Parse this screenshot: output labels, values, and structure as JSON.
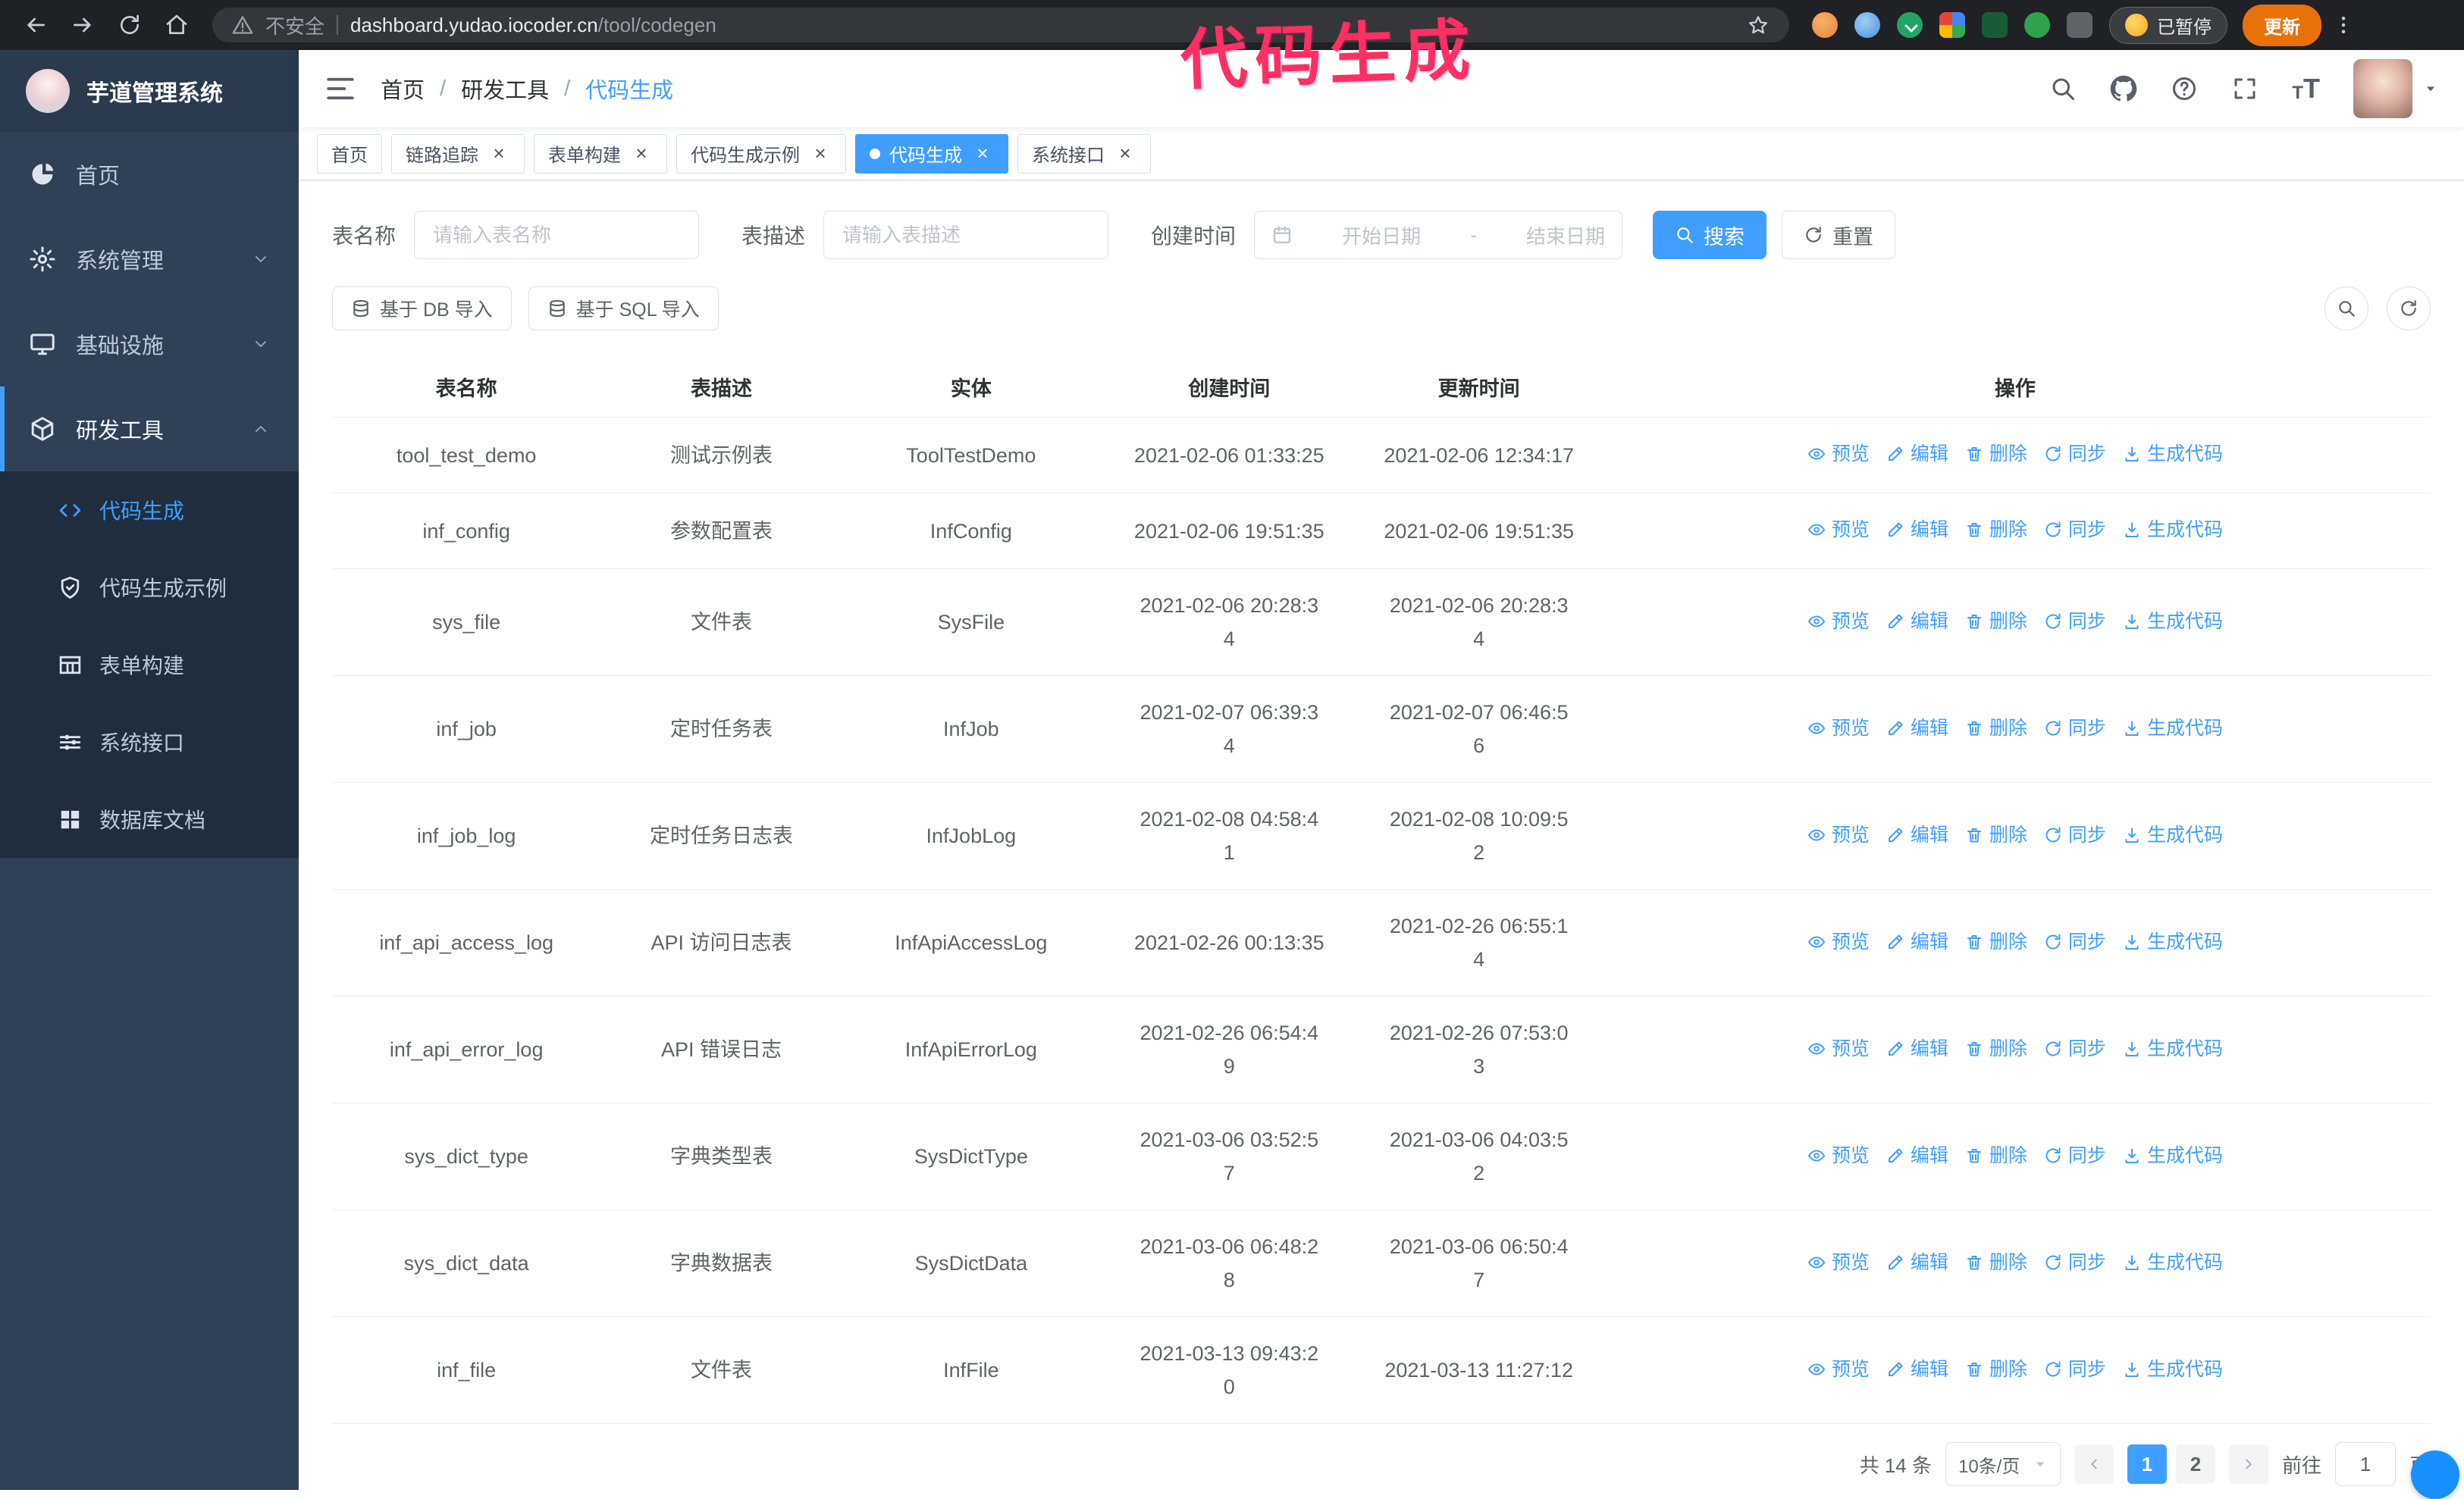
{
  "annotation": {
    "text": "代码生成",
    "color": "#ff2e63"
  },
  "colors": {
    "accent": "#409eff",
    "sidebar_bg": "#304156",
    "annotation": "#ff2e63",
    "update_button": "#e8710a"
  },
  "browser": {
    "security_label": "不安全",
    "url_host": "dashboard.yudao.iocoder.cn",
    "url_path": "/tool/codegen",
    "paused_badge": "已暂停",
    "update_button": "更新"
  },
  "sidebar": {
    "app_title": "芋道管理系统",
    "items": [
      {
        "id": "home",
        "label": "首页",
        "icon": "dashboard",
        "expandable": false
      },
      {
        "id": "system",
        "label": "系统管理",
        "icon": "gear",
        "expandable": true
      },
      {
        "id": "infra",
        "label": "基础设施",
        "icon": "monitor",
        "expandable": true
      },
      {
        "id": "dev-tools",
        "label": "研发工具",
        "icon": "cube",
        "expandable": true,
        "expanded": true,
        "active_parent": true
      }
    ],
    "subitems": [
      {
        "id": "codegen",
        "label": "代码生成",
        "icon": "code",
        "active": true
      },
      {
        "id": "codegen-example",
        "label": "代码生成示例",
        "icon": "shield"
      },
      {
        "id": "form-builder",
        "label": "表单构建",
        "icon": "table"
      },
      {
        "id": "system-api",
        "label": "系统接口",
        "icon": "sliders"
      },
      {
        "id": "db-doc",
        "label": "数据库文档",
        "icon": "grid"
      }
    ]
  },
  "header": {
    "breadcrumb": [
      "首页",
      "研发工具",
      "代码生成"
    ]
  },
  "tabs": [
    {
      "id": "home",
      "label": "首页",
      "closable": false
    },
    {
      "id": "tracer",
      "label": "链路追踪",
      "closable": true
    },
    {
      "id": "form-builder",
      "label": "表单构建",
      "closable": true
    },
    {
      "id": "codegen-example",
      "label": "代码生成示例",
      "closable": true
    },
    {
      "id": "codegen",
      "label": "代码生成",
      "closable": true,
      "active": true
    },
    {
      "id": "system-api",
      "label": "系统接口",
      "closable": true
    }
  ],
  "filters": {
    "table_name_label": "表名称",
    "table_name_placeholder": "请输入表名称",
    "table_desc_label": "表描述",
    "table_desc_placeholder": "请输入表描述",
    "create_time_label": "创建时间",
    "date_start_placeholder": "开始日期",
    "date_separator": "-",
    "date_end_placeholder": "结束日期",
    "search_button": "搜索",
    "reset_button": "重置"
  },
  "toolbar": {
    "import_db_button": "基于 DB 导入",
    "import_sql_button": "基于 SQL 导入"
  },
  "table": {
    "columns": [
      "表名称",
      "表描述",
      "实体",
      "创建时间",
      "更新时间",
      "操作"
    ],
    "ops": [
      {
        "id": "preview",
        "label": "预览",
        "icon": "eye"
      },
      {
        "id": "edit",
        "label": "编辑",
        "icon": "edit"
      },
      {
        "id": "delete",
        "label": "删除",
        "icon": "delete"
      },
      {
        "id": "sync",
        "label": "同步",
        "icon": "sync"
      },
      {
        "id": "generate-code",
        "label": "生成代码",
        "icon": "download"
      }
    ],
    "rows": [
      {
        "name": "tool_test_demo",
        "desc": "测试示例表",
        "entity": "ToolTestDemo",
        "created": "2021-02-06 01:33:25",
        "updated": "2021-02-06 12:34:17"
      },
      {
        "name": "inf_config",
        "desc": "参数配置表",
        "entity": "InfConfig",
        "created": "2021-02-06 19:51:35",
        "updated": "2021-02-06 19:51:35"
      },
      {
        "name": "sys_file",
        "desc": "文件表",
        "entity": "SysFile",
        "created": "2021-02-06 20:28:3\n4",
        "updated": "2021-02-06 20:28:3\n4"
      },
      {
        "name": "inf_job",
        "desc": "定时任务表",
        "entity": "InfJob",
        "created": "2021-02-07 06:39:3\n4",
        "updated": "2021-02-07 06:46:5\n6"
      },
      {
        "name": "inf_job_log",
        "desc": "定时任务日志表",
        "entity": "InfJobLog",
        "created": "2021-02-08 04:58:4\n1",
        "updated": "2021-02-08 10:09:5\n2"
      },
      {
        "name": "inf_api_access_log",
        "desc": "API 访问日志表",
        "entity": "InfApiAccessLog",
        "created": "2021-02-26 00:13:35",
        "updated": "2021-02-26 06:55:1\n4"
      },
      {
        "name": "inf_api_error_log",
        "desc": "API 错误日志",
        "entity": "InfApiErrorLog",
        "created": "2021-02-26 06:54:4\n9",
        "updated": "2021-02-26 07:53:0\n3"
      },
      {
        "name": "sys_dict_type",
        "desc": "字典类型表",
        "entity": "SysDictType",
        "created": "2021-03-06 03:52:5\n7",
        "updated": "2021-03-06 04:03:5\n2"
      },
      {
        "name": "sys_dict_data",
        "desc": "字典数据表",
        "entity": "SysDictData",
        "created": "2021-03-06 06:48:2\n8",
        "updated": "2021-03-06 06:50:4\n7"
      },
      {
        "name": "inf_file",
        "desc": "文件表",
        "entity": "InfFile",
        "created": "2021-03-13 09:43:2\n0",
        "updated": "2021-03-13 11:27:12"
      }
    ]
  },
  "pagination": {
    "total": "共 14 条",
    "page_size": "10条/页",
    "pages": [
      "1",
      "2"
    ],
    "active_page": "1",
    "goto_label": "前往",
    "goto_value": "1",
    "goto_suffix": "页"
  }
}
